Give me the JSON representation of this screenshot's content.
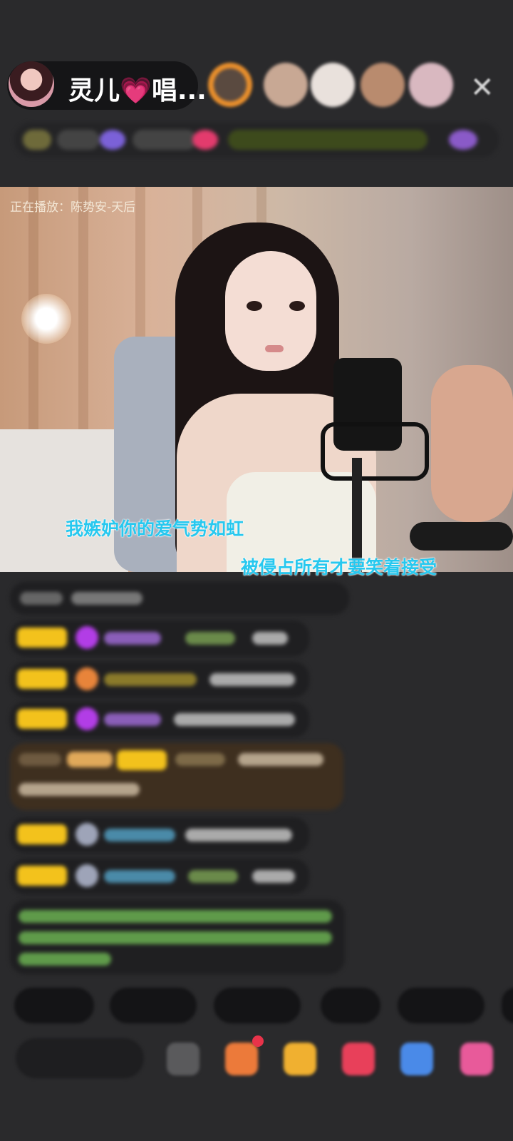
{
  "header": {
    "host_name": "灵儿💗唱..."
  },
  "video": {
    "now_playing": "正在播放：陈势安-天后",
    "lyric_line_1": "我嫉妒你的爱气势如虹",
    "lyric_line_2": "被侵占所有才要笑着接受"
  },
  "icons": {
    "close": "✕"
  },
  "colors": {
    "background": "#2a2a2c",
    "lyric": "#27c8ef",
    "level_badge": "#f3c21c",
    "gem": "#b23de6"
  }
}
